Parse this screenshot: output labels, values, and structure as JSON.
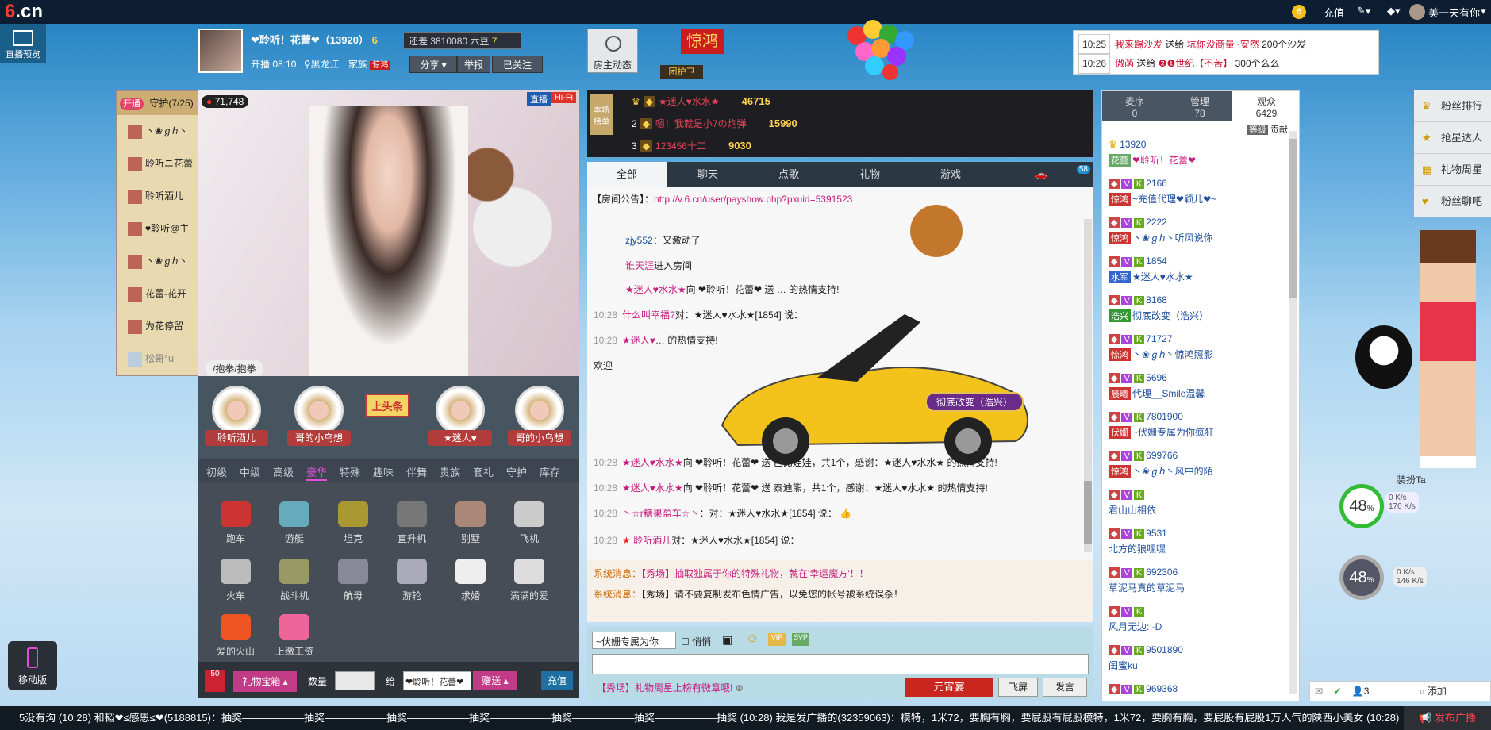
{
  "topbar": {
    "logo_main": "6",
    "logo_suffix": ".cn",
    "coin": "6",
    "recharge": "充值",
    "edit_icon": "edit-icon",
    "user_name": "美一天有你"
  },
  "header": {
    "preview_label": "直播预览",
    "host_name": "❤聆听！花蕾❤（13920）",
    "host_level": "6",
    "gap_text": "还差 3810080 六豆",
    "gap_level": "7",
    "start_time": "开播 08:10",
    "location": "黑龙江",
    "family_label": "家族",
    "family_tag": "惊鸿",
    "share": "分享",
    "report": "举报",
    "follow": "已关注",
    "owner_dynamic": "房主动态",
    "jinghong": "惊鸿",
    "guard_tag": "团护卫"
  },
  "notices": [
    {
      "time": "10:25",
      "user": "我来踢沙发",
      "action": "送给",
      "target": "坑你没商量~安然",
      "amount": "200个沙发"
    },
    {
      "time": "10:26",
      "user": "傲菡",
      "action": "送给",
      "target": "❷❶世纪【不苦】",
      "amount": "300个么么"
    }
  ],
  "guard_panel": {
    "open": "开通",
    "title": "守护(7/25)",
    "items": [
      "丶❀ℊℎ丶",
      "聆听ニ花蕾",
      "聆听酒儿",
      "♥聆听@主",
      "丶❀ℊℎ丶",
      "花蕾-花开",
      "为花停留",
      "松哥°ս"
    ]
  },
  "video": {
    "fans_count": "71,748",
    "live_badge": "直播",
    "hifi_badge": "Hi-Fi",
    "caption": "/抱拳/抱拳"
  },
  "fans_row": {
    "fans": [
      "聆听酒儿",
      "哥的小鸟想",
      "★迷人♥",
      "哥的小鸟想"
    ],
    "headline": "上头条"
  },
  "gift_tabs": [
    "初级",
    "中级",
    "高级",
    "豪华",
    "特殊",
    "趣味",
    "伴舞",
    "贵族",
    "套礼",
    "守护",
    "库存"
  ],
  "gift_active_tab": 3,
  "gifts": [
    "跑车",
    "游艇",
    "坦克",
    "直升机",
    "别墅",
    "飞机",
    "火车",
    "战斗机",
    "航母",
    "游轮",
    "求婚",
    "满满的爱",
    "爱的火山",
    "上缴工资"
  ],
  "gift_bar": {
    "badge": "50",
    "giftbox": "礼物宝箱",
    "qty_label": "数量",
    "give_label": "给",
    "recipient": "❤聆听！花蕾❤",
    "send": "赠送",
    "recharge": "充值"
  },
  "ranking": {
    "label": "本场榜单",
    "rows": [
      {
        "rank": "1",
        "name": "★迷人♥水水★",
        "value": "46715"
      },
      {
        "rank": "2",
        "name": "嗯！我就是小7の炮弹",
        "value": "15990"
      },
      {
        "rank": "3",
        "name": "123456十二",
        "value": "9030"
      }
    ]
  },
  "chat_tabs": [
    "全部",
    "聊天",
    "点歌",
    "礼物",
    "游戏"
  ],
  "car_count": "58",
  "chat": {
    "announce_label": "【房间公告】：",
    "announce_link": "http://v.6.cn/user/payshow.php?pxuid=5391523",
    "lines": [
      {
        "time": "",
        "user": "zjy552",
        "text": "：又激动了"
      },
      {
        "time": "",
        "user": "谁天涯",
        "text": "进入房间"
      },
      {
        "time": "",
        "user": "★迷人♥水水★",
        "text": "向 ❤聆听！花蕾❤ 送 … 的热情支持!"
      },
      {
        "time": "10:28",
        "user": "什么叫幸福?",
        "text": "对：★迷人♥水水★[1854] 说："
      },
      {
        "time": "10:28",
        "user": "★迷人♥",
        "text": "… 的热情支持!"
      },
      {
        "time": "",
        "user": "",
        "text": "欢迎"
      },
      {
        "time": "10:28",
        "user": "★迷人♥水水★",
        "text": "向 ❤聆听！花蕾❤ 送 芭比娃娃，共1个，感谢：★迷人♥水水★ 的热情支持!"
      },
      {
        "time": "10:28",
        "user": "★迷人♥水水★",
        "text": "向 ❤聆听！花蕾❤ 送 泰迪熊，共1个，感谢：★迷人♥水水★ 的热情支持!"
      },
      {
        "time": "10:28",
        "user": "丶☆r糖果盈车☆丶",
        "text": "：对：★迷人♥水水★[1854] 说："
      },
      {
        "time": "10:28",
        "user": "聆听酒儿",
        "text": "对：★迷人♥水水★[1854] 说："
      }
    ],
    "car_label": "彻底改变（浩兴）"
  },
  "system_msgs": [
    {
      "label": "系统消息：",
      "text": "【秀场】抽取独属于你的特殊礼物，就在'幸运魔方'！！"
    },
    {
      "label": "系统消息：",
      "text": "【秀场】请不要复制发布色情广告，以免您的帐号被系统误杀！"
    }
  ],
  "chat_input": {
    "target": "~伏姗专属为你",
    "quiet": "悄悄",
    "tip": "【秀场】礼物周星上榜有微章哦!",
    "lantern": "元宵宴",
    "fly": "飞屏",
    "send": "发言"
  },
  "user_panel": {
    "tabs": [
      {
        "label": "麦序",
        "count": "0"
      },
      {
        "label": "管理",
        "count": "78"
      },
      {
        "label": "观众",
        "count": "6429"
      }
    ],
    "sort_level": "等级",
    "sort_contrib": "贡献",
    "users": [
      {
        "id": "13920",
        "tag": "花蕾",
        "name": "❤聆听！花蕾❤"
      },
      {
        "id": "2166",
        "tag": "惊鸿",
        "name": "~充值代理❤颖儿❤~"
      },
      {
        "id": "2222",
        "tag": "惊鸿",
        "name": "丶❀ℊℎ丶听风说你"
      },
      {
        "id": "1854",
        "tag": "水军",
        "name": "★迷人♥水水★"
      },
      {
        "id": "8168",
        "tag": "浩兴",
        "name": "彻底改变（浩兴）"
      },
      {
        "id": "71727",
        "tag": "惊鸿",
        "name": "丶❀ℊℎ丶惊鸿照影"
      },
      {
        "id": "5696",
        "tag": "晨曦",
        "name": "代理__Smile温馨"
      },
      {
        "id": "7801900",
        "tag": "伏姗",
        "name": "~伏姗专属为你疯狂"
      },
      {
        "id": "699766",
        "tag": "惊鸿",
        "name": "丶❀ℊℎ丶风中的陌"
      },
      {
        "id": "",
        "tag": "",
        "name": "君山山相依"
      },
      {
        "id": "9531",
        "tag": "",
        "name": "北方的狼嘿嘿"
      },
      {
        "id": "692306",
        "tag": "",
        "name": "草泥马真的草泥马"
      },
      {
        "id": "",
        "tag": "",
        "name": "风月无边: -D"
      },
      {
        "id": "9501890",
        "tag": "",
        "name": "闺蜜ku"
      },
      {
        "id": "969368",
        "tag": "",
        "name": ""
      }
    ]
  },
  "side_menu": [
    "粉丝排行",
    "抢星达人",
    "礼物周星",
    "粉丝聊吧"
  ],
  "meters": [
    {
      "percent": "48",
      "up": "0 K/s",
      "down": "170 K/s"
    },
    {
      "percent": "48",
      "up": "0 K/s",
      "down": "146 K/s"
    }
  ],
  "dress_btn": "装扮Ta",
  "mobile_btn": "移动版",
  "util_bar": {
    "count": "3",
    "add": "添加"
  },
  "bottom_bar": {
    "text": "5没有沟 (10:28)  和韬❤≤感恩≤❤(5188815)：抽奖——————抽奖——————抽奖——————抽奖——————抽奖——————抽奖——————抽奖 (10:28)  我是发广播的(32359063)：模特，1米72，要胸有胸，要屁股有屁股模特，1米72，要胸有胸，要屁股有屁股1万人气的陕西小美女 (10:28)",
    "broadcast": "发布广播"
  }
}
